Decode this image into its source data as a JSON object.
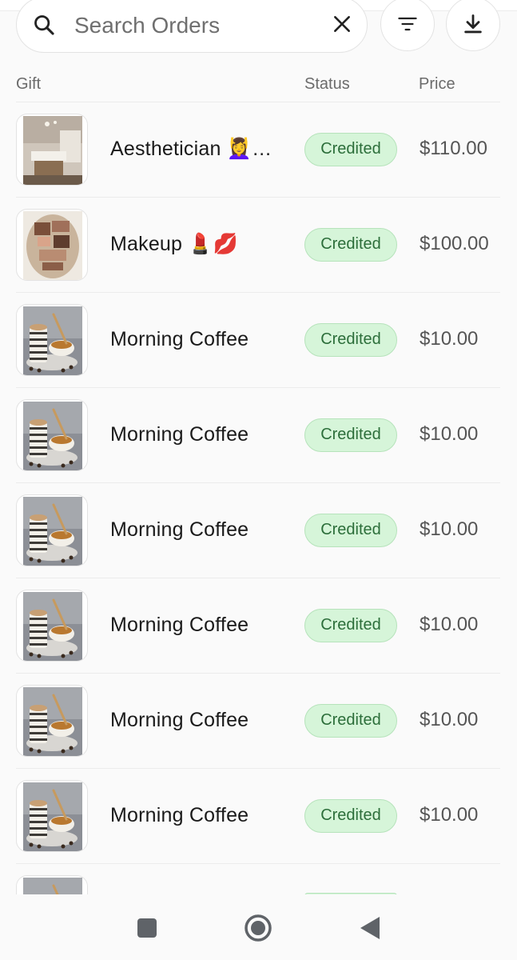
{
  "search": {
    "placeholder": "Search Orders"
  },
  "table": {
    "headers": {
      "gift": "Gift",
      "status": "Status",
      "price": "Price"
    },
    "rows": [
      {
        "thumbnail": "spa-room-image",
        "name": "Aesthetician 💆‍♀️…",
        "status": "Credited",
        "price": "$110.00"
      },
      {
        "thumbnail": "makeup-bag-image",
        "name": "Makeup 💄💋",
        "status": "Credited",
        "price": "$100.00"
      },
      {
        "thumbnail": "coffee-cups-image",
        "name": "Morning Coffee",
        "status": "Credited",
        "price": "$10.00"
      },
      {
        "thumbnail": "coffee-cups-image",
        "name": "Morning Coffee",
        "status": "Credited",
        "price": "$10.00"
      },
      {
        "thumbnail": "coffee-cups-image",
        "name": "Morning Coffee",
        "status": "Credited",
        "price": "$10.00"
      },
      {
        "thumbnail": "coffee-cups-image",
        "name": "Morning Coffee",
        "status": "Credited",
        "price": "$10.00"
      },
      {
        "thumbnail": "coffee-cups-image",
        "name": "Morning Coffee",
        "status": "Credited",
        "price": "$10.00"
      },
      {
        "thumbnail": "coffee-cups-image",
        "name": "Morning Coffee",
        "status": "Credited",
        "price": "$10.00"
      },
      {
        "thumbnail": "coffee-cups-image",
        "name": "",
        "status": "",
        "price": ""
      }
    ]
  },
  "colors": {
    "badge_bg": "#d6f5d9",
    "badge_text": "#2c6e3a",
    "badge_border": "#b6e3bb"
  },
  "icons": {
    "search": "search-icon",
    "clear": "close-icon",
    "filter": "filter-icon",
    "download": "download-icon",
    "nav_recent": "square-icon",
    "nav_home": "circle-icon",
    "nav_back": "triangle-back-icon"
  }
}
